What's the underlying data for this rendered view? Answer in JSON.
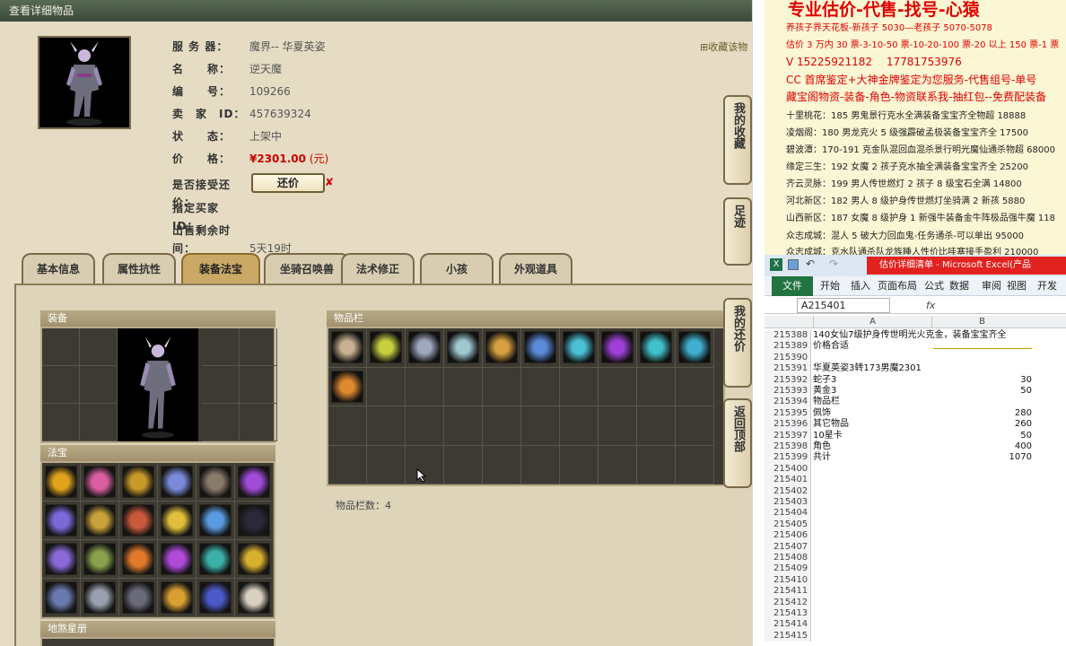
{
  "game_window": {
    "title": "查看详细物品",
    "favorite_link": "收藏该物",
    "info": [
      {
        "label": "服 务 器：",
        "value": "魔界-- 华夏英姿"
      },
      {
        "label": "名　　称：",
        "value": "逆天魔"
      },
      {
        "label": "编　　号：",
        "value": "109266"
      },
      {
        "label": "卖　家　ID：",
        "value": "457639324"
      },
      {
        "label": "状　　态：",
        "value": "上架中"
      }
    ],
    "price_label": "价　　格：",
    "price_value": "¥2301.00",
    "price_unit": "(元)",
    "counter_offer_label": "是否接受还价：",
    "counter_offer_button": "还价",
    "counter_offer_mark": "✘",
    "buyer_id_label": "指定买家 ID：",
    "remaining_label": "出售剩余时间：",
    "remaining_value": "5天19时",
    "tabs": [
      "基本信息",
      "属性抗性",
      "装备法宝",
      "坐骑召唤兽",
      "法术修正",
      "小孩",
      "外观道具"
    ],
    "active_tab": "装备法宝",
    "panels": {
      "equipment": "装备",
      "treasure": "法宝",
      "inventory": "物品栏",
      "star_book": "地煞星册"
    },
    "inventory_count": "物品栏数：4",
    "side_rail": [
      "我的收藏",
      "足迹",
      "我的还价",
      "返回顶部"
    ],
    "colors": {
      "accent": "#c9a965",
      "price": "#cc0000",
      "panel_dark": "#3c3a33"
    }
  },
  "promo": {
    "title": "专业估价-代售-找号-心猿",
    "lines": [
      {
        "text": "养孩子界天花板-新孩子 5030—老孩子 5070-5078",
        "style": "red"
      },
      {
        "text": "估价 3 万内 30 票-3-10-50 票-10-20-100 票-20 以上 150 票-1 票",
        "style": "red"
      },
      {
        "text": "V 15225921182　 17781753976 ",
        "style": "red big"
      },
      {
        "text": "CC 首席鉴定+大神金牌鉴定为您服务-代售组号-单号",
        "style": "red big"
      },
      {
        "text": "藏宝阁物资-装备-角色-物资联系我-抽红包--免费配装备",
        "style": "red big"
      },
      {
        "text": "十里桃花：185 男鬼景行克水全满装备宝宝齐全物超 18888",
        "style": "dark"
      },
      {
        "text": "凌烟阁：180 男龙克火 5 级强霹破孟极装备宝宝齐全 17500",
        "style": "dark"
      },
      {
        "text": "碧波潭：170-191 克金队混回血混杀景行明光魔仙通杀物超 68000",
        "style": "dark"
      },
      {
        "text": "缘定三生：192 女魔 2 孩子克水抽全满装备宝宝齐全 25200",
        "style": "dark"
      },
      {
        "text": "齐云灵脉：199 男人传世燃灯 2 孩子 8 级宝石全满 14800",
        "style": "dark"
      },
      {
        "text": "河北新区：182 男人 8 级护身传世燃灯坐骑满 2 新孩 5880",
        "style": "dark"
      },
      {
        "text": "山西新区：187 女魔 8 级护身 1 新强牛装备金牛阵极品强牛魔 118",
        "style": "dark"
      },
      {
        "text": "众志成城：混人 5 破大力回血鬼-任务通杀-可以单出 95000",
        "style": "dark"
      },
      {
        "text": "众志成城：克水队通杀队龙族睡人性价比哇塞接手盈利 210000",
        "style": "dark"
      }
    ]
  },
  "excel": {
    "window_title": "估价详细清单 - Microsoft Excel(产品",
    "ribbon_tabs": [
      "文件",
      "开始",
      "插入",
      "页面布局",
      "公式",
      "数据",
      "审阅",
      "视图",
      "开发工"
    ],
    "name_box": "A215401",
    "fx": "fx",
    "column_headers": [
      "A",
      "B"
    ],
    "rows": [
      {
        "n": "215388",
        "a": "140女仙7级护身传世明光火克金，装备宝宝齐全",
        "b": ""
      },
      {
        "n": "215389",
        "a": "价格合适",
        "b": ""
      },
      {
        "n": "215390",
        "a": "",
        "b": ""
      },
      {
        "n": "215391",
        "a": "华夏英姿3转173男魔2301",
        "b": ""
      },
      {
        "n": "215392",
        "a": "蛇子3",
        "b": "30"
      },
      {
        "n": "215393",
        "a": "黄金3",
        "b": "50"
      },
      {
        "n": "215394",
        "a": "物品栏",
        "b": ""
      },
      {
        "n": "215395",
        "a": "佩饰",
        "b": "280"
      },
      {
        "n": "215396",
        "a": "其它物品",
        "b": "260"
      },
      {
        "n": "215397",
        "a": "10星卡",
        "b": "50"
      },
      {
        "n": "215398",
        "a": "角色",
        "b": "400"
      },
      {
        "n": "215399",
        "a": "共计",
        "b": "1070"
      },
      {
        "n": "215400",
        "a": "",
        "b": ""
      },
      {
        "n": "215401",
        "a": "",
        "b": ""
      },
      {
        "n": "215402",
        "a": "",
        "b": ""
      },
      {
        "n": "215403",
        "a": "",
        "b": ""
      },
      {
        "n": "215404",
        "a": "",
        "b": ""
      },
      {
        "n": "215405",
        "a": "",
        "b": ""
      },
      {
        "n": "215406",
        "a": "",
        "b": ""
      },
      {
        "n": "215407",
        "a": "",
        "b": ""
      },
      {
        "n": "215408",
        "a": "",
        "b": ""
      },
      {
        "n": "215409",
        "a": "",
        "b": ""
      },
      {
        "n": "215410",
        "a": "",
        "b": ""
      },
      {
        "n": "215411",
        "a": "",
        "b": ""
      },
      {
        "n": "215412",
        "a": "",
        "b": ""
      },
      {
        "n": "215413",
        "a": "",
        "b": ""
      },
      {
        "n": "215414",
        "a": "",
        "b": ""
      },
      {
        "n": "215415",
        "a": "",
        "b": ""
      }
    ]
  }
}
